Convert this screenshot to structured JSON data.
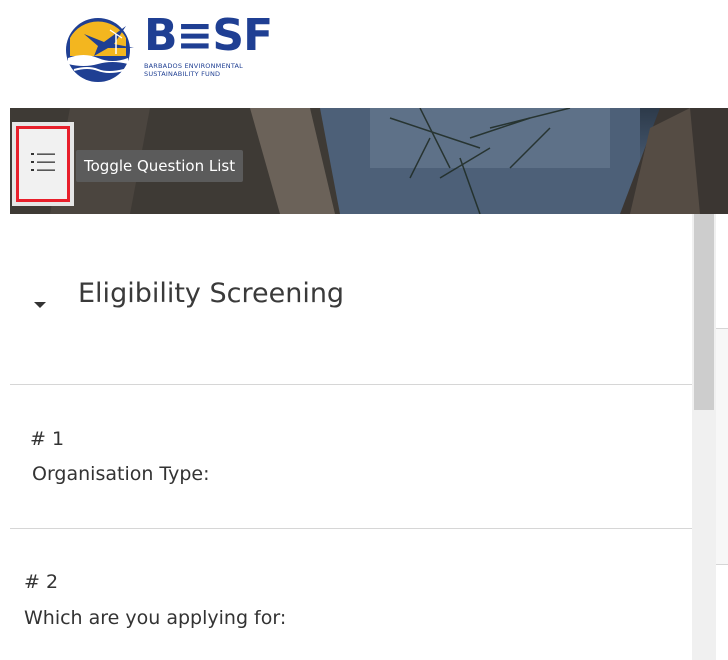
{
  "brand": {
    "wordmark": "B≡SF",
    "subtitle_line1": "BARBADOS ENVIRONMENTAL",
    "subtitle_line2": "SUSTAINABILITY FUND",
    "color_primary": "#1f3f93",
    "color_accent": "#f3b61f"
  },
  "toolbar": {
    "toggle_icon": "list-icon",
    "tooltip": "Toggle Question List",
    "highlight_color": "#e81f2b"
  },
  "section": {
    "title": "Eligibility Screening",
    "expanded": true
  },
  "questions": [
    {
      "number": "# 1",
      "text": "Organisation Type:"
    },
    {
      "number": "# 2",
      "text": "Which are you applying for:"
    }
  ]
}
